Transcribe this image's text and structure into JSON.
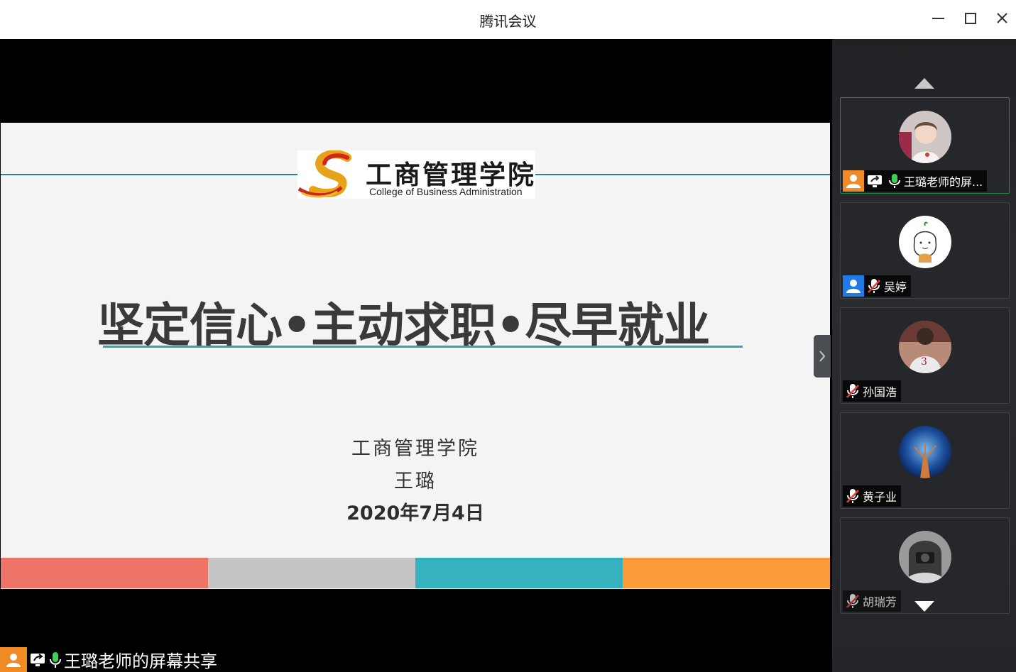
{
  "window": {
    "title": "腾讯会议"
  },
  "slide": {
    "logo_cn": "工商管理学院",
    "logo_en": "College of Business Administration",
    "headline": "坚定信心•主动求职•尽早就业",
    "org": "工商管理学院",
    "presenter": "王璐",
    "date": "2020年7月4日",
    "bar_colors": [
      "#ee7468",
      "#c4c4c4",
      "#36b1bf",
      "#fb9b3a"
    ]
  },
  "sharebar": {
    "label": "王璐老师的屏幕共享"
  },
  "participants": [
    {
      "name": "王璐老师的屏...",
      "role": "host",
      "sharing": true,
      "mic": "on",
      "avatar": "girl-photo"
    },
    {
      "name": "吴婷",
      "role": "cohost",
      "sharing": false,
      "mic": "muted",
      "avatar": "drawing"
    },
    {
      "name": "孙国浩",
      "role": "member",
      "sharing": false,
      "mic": "muted",
      "avatar": "basketball"
    },
    {
      "name": "黄子业",
      "role": "member",
      "sharing": false,
      "mic": "muted",
      "avatar": "blue-art"
    },
    {
      "name": "胡瑞芳",
      "role": "member",
      "sharing": false,
      "mic": "muted",
      "avatar": "camera"
    }
  ],
  "colors": {
    "host_badge": "#f08a24",
    "cohost_badge": "#1e7ae8",
    "active_border": "#1f8a4c",
    "teal": "#2fa7b3"
  }
}
